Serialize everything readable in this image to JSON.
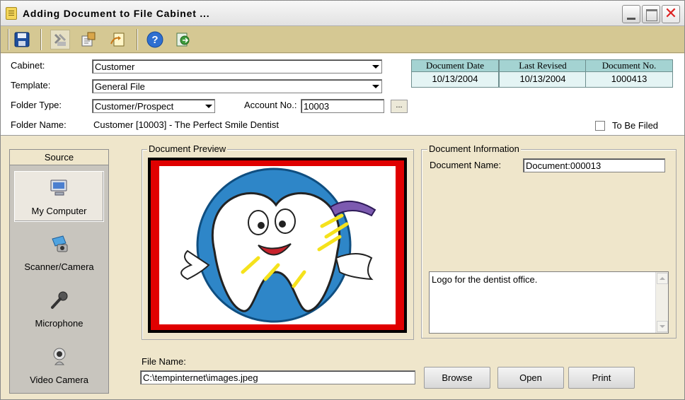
{
  "window": {
    "title": "Adding Document to File Cabinet ...",
    "close_glyph": "✕"
  },
  "toolbar": {
    "icons": [
      "save-icon",
      "scan-icon",
      "import-icon",
      "export-icon",
      "help-icon",
      "exit-icon"
    ]
  },
  "header": {
    "cabinet_label": "Cabinet:",
    "cabinet_value": "Customer",
    "template_label": "Template:",
    "template_value": "General File",
    "folder_type_label": "Folder Type:",
    "folder_type_value": "Customer/Prospect",
    "account_label": "Account No.:",
    "account_value": "10003",
    "browse_dots": "...",
    "folder_name_label": "Folder Name:",
    "folder_name_value": "Customer [10003] - The Perfect Smile Dentist",
    "to_be_filed_label": "To Be Filed",
    "to_be_filed_checked": false
  },
  "dates": {
    "document_date_label": "Document Date",
    "document_date_value": "10/13/2004",
    "last_revised_label": "Last Revised",
    "last_revised_value": "10/13/2004",
    "document_no_label": "Document No.",
    "document_no_value": "1000413"
  },
  "source": {
    "heading": "Source",
    "items": [
      {
        "label": "My Computer",
        "icon": "computer-icon",
        "selected": true
      },
      {
        "label": "Scanner/Camera",
        "icon": "scanner-icon",
        "selected": false
      },
      {
        "label": "Microphone",
        "icon": "microphone-icon",
        "selected": false
      },
      {
        "label": "Video Camera",
        "icon": "webcam-icon",
        "selected": false
      }
    ]
  },
  "preview": {
    "label": "Document Preview"
  },
  "doc_info": {
    "label": "Document Information",
    "name_label": "Document Name:",
    "name_value": "Document:000013",
    "description": "Logo for the dentist office."
  },
  "file": {
    "label": "File Name:",
    "value": "C:\\tempinternet\\images.jpeg"
  },
  "buttons": {
    "browse": "Browse",
    "open": "Open",
    "print": "Print"
  },
  "colors": {
    "toolbar": "#D5C893",
    "date_header": "#A4D3D2",
    "window_bg": "#EFE6CB",
    "preview_border": "#E00000"
  }
}
